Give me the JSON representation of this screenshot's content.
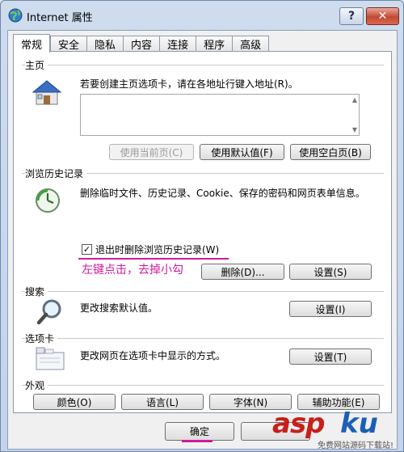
{
  "window": {
    "title": "Internet 属性",
    "help_glyph": "?",
    "close_glyph": "✕"
  },
  "tabs": [
    "常规",
    "安全",
    "隐私",
    "内容",
    "连接",
    "程序",
    "高级"
  ],
  "home": {
    "label": "主页",
    "description": "若要创建主页选项卡，请在各地址行键入地址(R)。",
    "address_value": "",
    "buttons": {
      "use_current": "使用当前页(C)",
      "use_default": "使用默认值(F)",
      "use_blank": "使用空白页(B)"
    }
  },
  "history": {
    "label": "浏览历史记录",
    "description": "删除临时文件、历史记录、Cookie、保存的密码和网页表单信息。",
    "checkbox_label": "退出时删除浏览历史记录(W)",
    "checkbox_checked": true,
    "checkmark": "✓",
    "buttons": {
      "delete": "删除(D)...",
      "settings": "设置(S)"
    }
  },
  "annotation": {
    "text": "左键点击，去掉小勾"
  },
  "search": {
    "label": "搜索",
    "description": "更改搜索默认值。",
    "buttons": {
      "settings": "设置(I)"
    }
  },
  "tabs_section": {
    "label": "选项卡",
    "description": "更改网页在选项卡中显示的方式。",
    "buttons": {
      "settings": "设置(T)"
    }
  },
  "appearance": {
    "label": "外观",
    "buttons": {
      "colors": "颜色(O)",
      "languages": "语言(L)",
      "fonts": "字体(N)",
      "accessibility": "辅助功能(E)"
    }
  },
  "footer": {
    "ok": "确定"
  },
  "watermark": {
    "brand_a": "asp",
    "brand_b": "ku",
    "sub": "免费网站源码下载站!"
  },
  "colors": {
    "accent": "#d01a9c"
  }
}
